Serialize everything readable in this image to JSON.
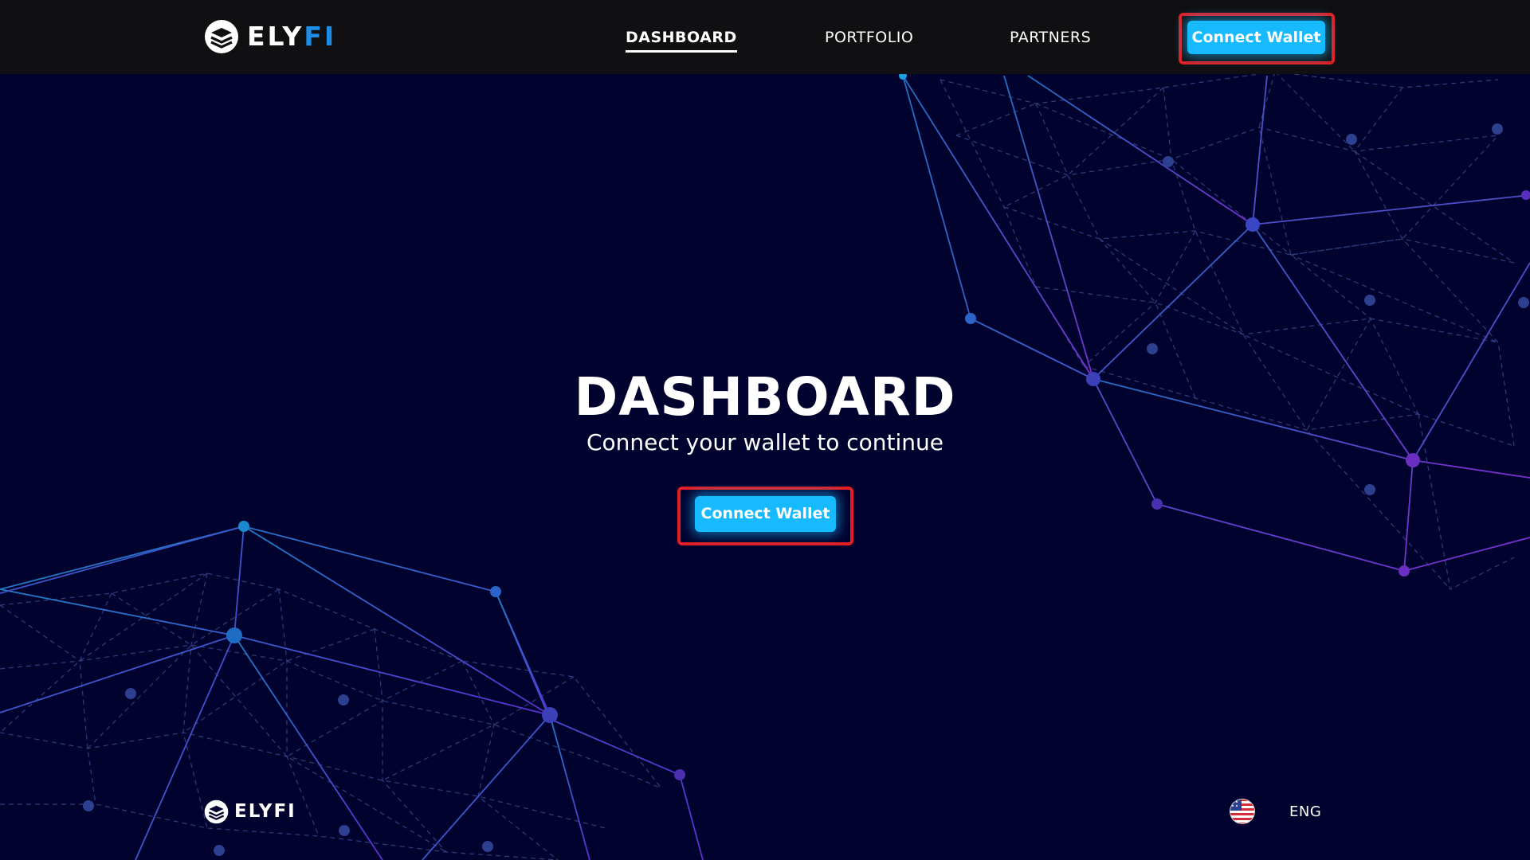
{
  "brand": {
    "name_main": "ELY",
    "name_accent": "FI",
    "icon": "elyfi-logo-icon",
    "accent_color": "#1e8de8"
  },
  "nav": {
    "items": [
      {
        "label": "DASHBOARD",
        "active": true
      },
      {
        "label": "PORTFOLIO",
        "active": false
      },
      {
        "label": "PARTNERS",
        "active": false
      }
    ],
    "connect_label": "Connect Wallet"
  },
  "hero": {
    "title": "DASHBOARD",
    "subtitle": "Connect your wallet to continue",
    "connect_label": "Connect Wallet"
  },
  "footer": {
    "brand_name": "ELYFI",
    "language": "ENG",
    "flag_icon": "us-flag-icon"
  },
  "colors": {
    "background": "#02022e",
    "navbar": "#101012",
    "button": "#17b9ff",
    "highlight": "#e31e24"
  }
}
